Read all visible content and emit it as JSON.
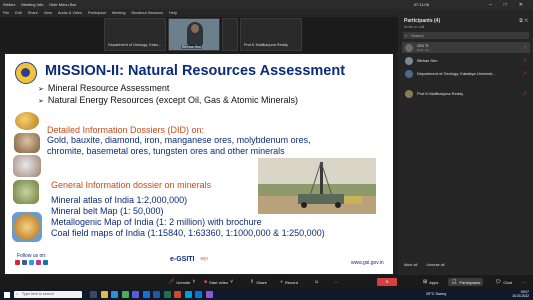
{
  "window": {
    "title_items": [
      "Webex",
      "Meeting Info",
      "Hide Menu Bar"
    ],
    "clock": "07:11:06",
    "controls": [
      "–",
      "□",
      "✕"
    ]
  },
  "menu": [
    "File",
    "Edit",
    "Share",
    "View",
    "Audio & Video",
    "Participant",
    "Meeting",
    "Breakout Sessions",
    "Help"
  ],
  "tiles": [
    {
      "name": "Department of Geology, Kaka..."
    },
    {
      "name": "Bibhas Sen"
    },
    {
      "name": ""
    },
    {
      "name": "Prof.K.Mallikarjuna Reddy"
    }
  ],
  "slide": {
    "title": "MISSION-II: Natural Resources Assessment",
    "bullets": [
      "Mineral Resource Assessment",
      "Natural Energy Resources (except Oil, Gas & Atomic Minerals)"
    ],
    "section1_heading": "Detailed Information Dossiers (DID) on:",
    "section1_lines": [
      "Gold, bauxite, diamond, iron, manganese ores, molybdenum ores,",
      "chromite, basemetal ores, tungsten ores and other minerals"
    ],
    "section2_heading": "General Information dossier on minerals",
    "section2_lines": [
      "Mineral atlas of India 1:2,000,000)",
      "Mineral belt Map (1: 50,000)",
      "Metallogenic Map of India (1: 2 million) with brochure",
      "Coal field maps of India (1:15840, 1:63360, 1:1000,000 &  1:250,000)"
    ],
    "follow": "Follow us on:",
    "brand": "e-GSITI",
    "brand_sub": "अमृत",
    "website": "www.gsi.gov.in"
  },
  "participants": {
    "header": "Participants (4)",
    "invite": "Invite or call",
    "search_placeholder": "Search",
    "list": [
      {
        "name": "GSI TI",
        "sub": "Host, me"
      },
      {
        "name": "Bibhas Sen",
        "sub": ""
      },
      {
        "name": "Department of Geology, Kakatiya Universit...",
        "sub": ""
      },
      {
        "name": "Prof.K.Mallikarjuna Reddy",
        "sub": ""
      }
    ],
    "mute_all": "Mute all",
    "unmute_all": "Unmute all"
  },
  "controls": {
    "unmute": "Unmute",
    "start_video": "Start video",
    "share": "Share",
    "record": "Record",
    "end": "✕",
    "apps": "Apps",
    "participants": "Participants",
    "chat": "Chat",
    "more": "···"
  },
  "taskbar": {
    "search_placeholder": "Type here to search",
    "weather": "29°C  Sunny",
    "time": "09:07",
    "date": "15-03-2022"
  }
}
